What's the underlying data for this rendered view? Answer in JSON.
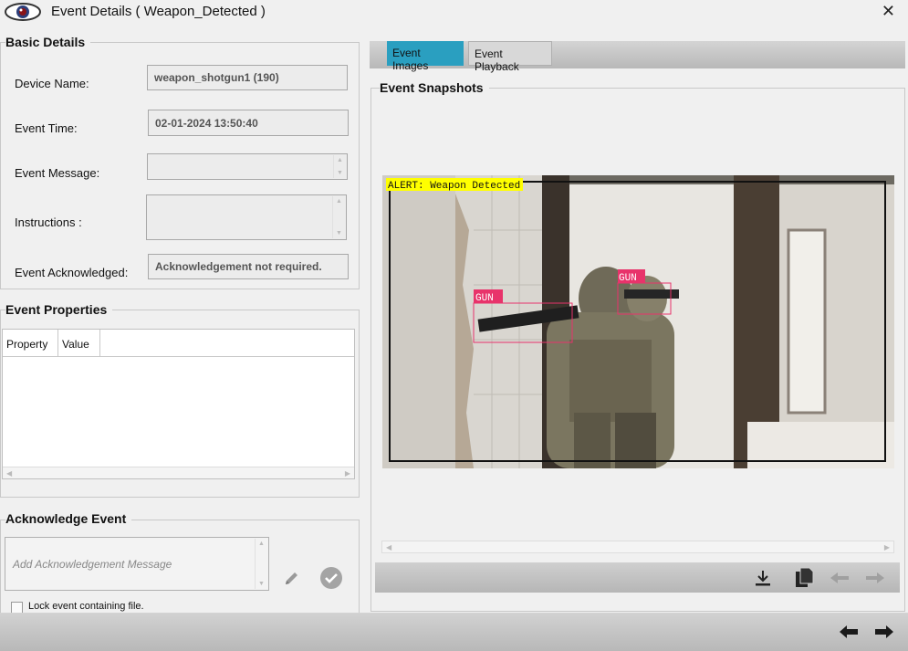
{
  "window": {
    "title": "Event Details ( Weapon_Detected )",
    "close_glyph": "✕"
  },
  "basic_details": {
    "heading": "Basic Details",
    "device_name_label": "Device Name:",
    "device_name_value": "weapon_shotgun1 (190)",
    "event_time_label": "Event Time:",
    "event_time_value": "02-01-2024 13:50:40",
    "event_message_label": "Event Message:",
    "event_message_value": "",
    "instructions_label": "Instructions :",
    "instructions_value": "",
    "event_ack_label": "Event Acknowledged:",
    "event_ack_value": "Acknowledgement not required."
  },
  "event_properties": {
    "heading": "Event Properties",
    "columns": [
      "Property",
      "Value"
    ]
  },
  "acknowledge": {
    "heading": "Acknowledge Event",
    "placeholder": "Add Acknowledgement Message",
    "lock_label": "Lock event containing file.",
    "lock_checked": false
  },
  "tabs": [
    {
      "label": "Event Images",
      "active": true
    },
    {
      "label": "Event Playback",
      "active": false
    }
  ],
  "snapshots": {
    "heading": "Event Snapshots",
    "alert_text": "ALERT: Weapon Detected",
    "detections": [
      "GUN",
      "GUN"
    ]
  },
  "icons": {
    "app": "eye-icon",
    "edit": "pencil-icon",
    "confirm": "check-circle-icon",
    "download": "download-icon",
    "copy": "copy-icon",
    "prev_snapshot": "arrow-left-icon",
    "next_snapshot": "arrow-right-icon",
    "prev_event": "arrow-left-icon",
    "next_event": "arrow-right-icon"
  },
  "colors": {
    "active_tab": "#2a9fc0",
    "alert_bg": "#ffff00",
    "detection_box": "#e8336b"
  }
}
